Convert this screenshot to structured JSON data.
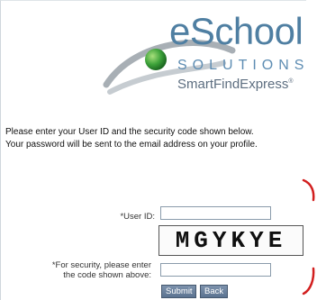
{
  "brand": {
    "name": "eSchool",
    "tagline": "SOLUTIONS",
    "product": "SmartFindExpress",
    "product_mark": "®",
    "colors": {
      "primary": "#4f7fa2",
      "accent_green": "#3da23a",
      "swoosh": "#9aa3aa"
    }
  },
  "instructions": {
    "line1": "Please enter your User ID and the security code shown below.",
    "line2": "Your password will be sent to the email address on your profile."
  },
  "form": {
    "user_id_label": "*User ID:",
    "user_id_value": "",
    "security_label_line1": "*For security, please enter",
    "security_label_line2": "the code shown above:",
    "security_value": "",
    "captcha_text": "MGYKYE",
    "submit_label": "Submit",
    "back_label": "Back"
  },
  "accent_colors": {
    "edge_bracket": "#d21f1f"
  }
}
